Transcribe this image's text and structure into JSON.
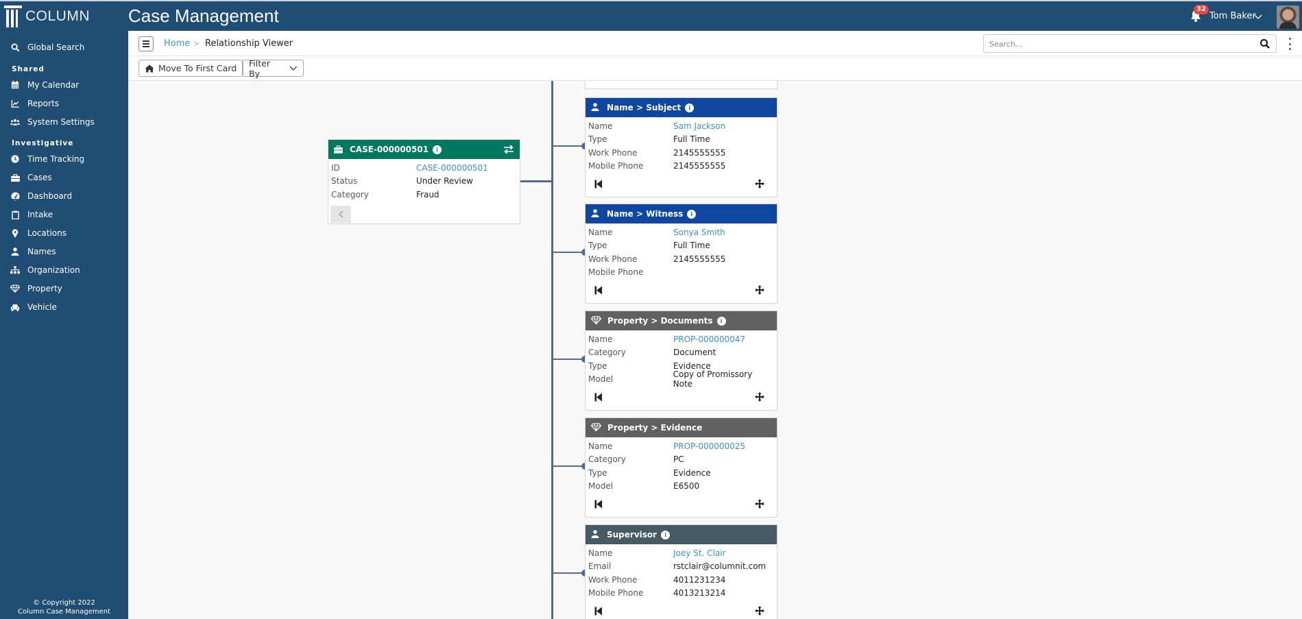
{
  "header": {
    "brand": "COLUMN",
    "app_title": "Case Management",
    "notifications_count": "32",
    "user_name": "Tom Baker"
  },
  "sidebar": {
    "global_search": "Global Search",
    "sections": [
      {
        "title": "Shared",
        "items": [
          {
            "label": "My Calendar",
            "icon": "calendar-icon"
          },
          {
            "label": "Reports",
            "icon": "chart-line-icon"
          },
          {
            "label": "System Settings",
            "icon": "users-icon"
          }
        ]
      },
      {
        "title": "Investigative",
        "items": [
          {
            "label": "Time Tracking",
            "icon": "clock-icon"
          },
          {
            "label": "Cases",
            "icon": "briefcase-icon"
          },
          {
            "label": "Dashboard",
            "icon": "gauge-icon"
          },
          {
            "label": "Intake",
            "icon": "clipboard-icon"
          },
          {
            "label": "Locations",
            "icon": "map-marker-icon"
          },
          {
            "label": "Names",
            "icon": "user-icon"
          },
          {
            "label": "Organization",
            "icon": "sitemap-icon"
          },
          {
            "label": "Property",
            "icon": "gem-icon"
          },
          {
            "label": "Vehicle",
            "icon": "car-icon"
          }
        ]
      }
    ],
    "copyright_line1": "© Copyright 2022",
    "copyright_line2": "Column Case Management"
  },
  "breadcrumb": {
    "home": "Home",
    "separator": ">",
    "current": "Relationship Viewer"
  },
  "search": {
    "placeholder": "Search...",
    "value": ""
  },
  "toolbar": {
    "move_first_label": "Move To First Card",
    "filter_label": "Filter By"
  },
  "case_card": {
    "title": "CASE-000000501",
    "color": "#00775f",
    "fields": [
      {
        "key": "ID",
        "value": "CASE-000000501",
        "link": true
      },
      {
        "key": "Status",
        "value": "Under Review",
        "link": false
      },
      {
        "key": "Category",
        "value": "Fraud",
        "link": false
      }
    ]
  },
  "related_cards": [
    {
      "title": "Name > Subject",
      "icon": "user-icon",
      "color": "#0f47a0",
      "has_info": true,
      "fields": [
        {
          "key": "Name",
          "value": "Sam Jackson",
          "link": true
        },
        {
          "key": "Type",
          "value": "Full Time",
          "link": false
        },
        {
          "key": "Work Phone",
          "value": "2145555555",
          "link": false
        },
        {
          "key": "Mobile Phone",
          "value": "2145555555",
          "link": false
        }
      ]
    },
    {
      "title": "Name > Witness",
      "icon": "user-icon",
      "color": "#0f47a0",
      "has_info": true,
      "fields": [
        {
          "key": "Name",
          "value": "Sonya Smith",
          "link": true
        },
        {
          "key": "Type",
          "value": "Full Time",
          "link": false
        },
        {
          "key": "Work Phone",
          "value": "2145555555",
          "link": false
        },
        {
          "key": "Mobile Phone",
          "value": "",
          "link": false
        }
      ]
    },
    {
      "title": "Property > Documents",
      "icon": "gem-icon",
      "color": "#616161",
      "has_info": true,
      "fields": [
        {
          "key": "Name",
          "value": "PROP-000000047",
          "link": true
        },
        {
          "key": "Category",
          "value": "Document",
          "link": false
        },
        {
          "key": "Type",
          "value": "Evidence",
          "link": false
        },
        {
          "key": "Model",
          "value": "Copy of Promissory Note",
          "link": false
        }
      ]
    },
    {
      "title": "Property > Evidence",
      "icon": "gem-icon",
      "color": "#616161",
      "has_info": false,
      "fields": [
        {
          "key": "Name",
          "value": "PROP-000000025",
          "link": true
        },
        {
          "key": "Category",
          "value": "PC",
          "link": false
        },
        {
          "key": "Type",
          "value": "Evidence",
          "link": false
        },
        {
          "key": "Model",
          "value": "E6500",
          "link": false
        }
      ]
    },
    {
      "title": "Supervisor",
      "icon": "user-icon",
      "color": "#455a64",
      "has_info": true,
      "fields": [
        {
          "key": "Name",
          "value": "Joey St. Clair",
          "link": true
        },
        {
          "key": "Email",
          "value": "rstclair@columnit.com",
          "link": false
        },
        {
          "key": "Work Phone",
          "value": "4011231234",
          "link": false
        },
        {
          "key": "Mobile Phone",
          "value": "4013213214",
          "link": false
        }
      ]
    }
  ]
}
